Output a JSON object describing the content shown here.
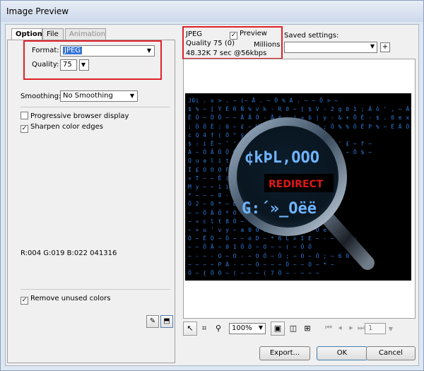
{
  "window": {
    "title": "Image Preview"
  },
  "tabs": [
    {
      "label": "Options",
      "active": true
    },
    {
      "label": "File",
      "active": false
    },
    {
      "label": "Animation",
      "active": false,
      "disabled": true
    }
  ],
  "options": {
    "format_label": "Format:",
    "format_value": "JPEG",
    "quality_label": "Quality:",
    "quality_value": "75",
    "smoothing_label": "Smoothing:",
    "smoothing_value": "No Smoothing",
    "progressive_label": "Progressive browser display",
    "progressive_checked": false,
    "sharpen_label": "Sharpen color edges",
    "sharpen_checked": true,
    "color_readout": "R:004 G:019 B:022 041316",
    "remove_unused_label": "Remove unused colors",
    "remove_unused_checked": true
  },
  "preview_info": {
    "format": "JPEG",
    "preview_label": "Preview",
    "preview_checked": true,
    "quality_line": "Quality 75 (0)",
    "colors": "Millions",
    "size_line": "48.32K  7 sec @56kbps"
  },
  "saved_settings": {
    "label": "Saved settings:",
    "value": ""
  },
  "image": {
    "banner_text": "REDIRECT",
    "code_lines": [
      "J0i  .  x  >  . ~ (~ Å  . ~ Ô  % Á . ~ ~ Ö  > ~",
      "$ % ~ [ Y È R Ñ % v k - R 0 ~ [ $ V - 2 g 0 1 ; Ä ô ' , ~ Ä  ~",
      "Ê Ó ~ Ö Ö ~ ~ Å Å Ô  - Ã $ _ | » b | y - & + Ô È - $ . 0 e x b E Ö ( Ó ~ ' Ó ~ (Ô Ä )",
      ": Ö Ö Ë : 0 ~ £ ~ H Ö Ä ' Ó Ö € À @ ; Ô % % Ö Ë P %  ~ Ë Ä Ö  ~",
      "c Q 4 f ( Ö ^ ÿ",
      "$ : i Ê ~ ¯ ' Ï E f § È » Ê . ¨ ¨ . | Ä ' £ ~ f ~",
      "Ä  ~ Ö Ã Ö Ö Ò ^ Ö Ô ? Ô Ò Ö ~ ~ ( Ö $ Ê ~ ~ Ô $ ~",
      "Q u a l i t y ° ~ Ä ~ ~ ~ ~ ~",
      "Ï £ O O O F Q O",
      "» T ~ ~ Ë ( ~ ~ . $  ~ Ä ~ ~",
      "M y ~ ~ i i i n - } p E ~",
      "* ~ ~ ~ 8 - ( - ( @ ~ ( ; ~ ( 3 .",
      "Ö 2 ~ 0 * ~ Ë ~ I ~ Ò ~ * D k Ö ~",
      "~ ~ Ö Ä Ö * Ó ~ , p ( Ö Ö Ö Ö ~ )",
      "~ » c l t 8 Ó ~ ~ b ~ 0 ~",
      "~ + u ' v y ~ a 0 0 o b b 0 O ~ 0 O e ~",
      "Ò ~ Ë Ö ~ Ö ~ ~ o D ~ * 6 L = I E ~ - ~ 0 Ë ~",
      "~ ~ Ô Ä ~ 0 1 Ö Ò ~ O ~ ~ ( ~ Ö Ó",
      "~ - ~ - O ~ O - ~ O Ö ~ Ö ; ~ O ~ Ó ; ~ 6 0",
      "~ ~ ~ ~ P Ä - ~ ~ O ~ ~ ~ Ö ~ ~ O ~ * ~",
      "Ö ~ { Ô Ò ~ ( ~ ~ ~ ( 7 Ö ~ - ~ ~ ~"
    ]
  },
  "toolbar": {
    "zoom_value": "100%",
    "page_value": "1"
  },
  "buttons": {
    "export": "Export...",
    "ok": "OK",
    "cancel": "Cancel"
  },
  "colors": {
    "accent_highlight": "#3875d7",
    "annotation_red": "#e0202a",
    "code_blue": "#2f7ad8",
    "banner_red": "#e01818"
  }
}
